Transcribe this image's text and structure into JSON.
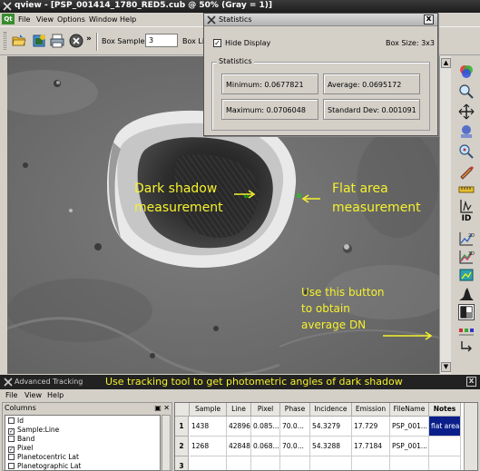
{
  "window": {
    "title": "qview - [PSP_001414_1780_RED5.cub @ 50% (Gray = 1)]"
  },
  "menubar": {
    "logo": "Qt",
    "items": [
      "File",
      "View",
      "Options",
      "Window",
      "Help"
    ]
  },
  "toolbar": {
    "overflow": "»",
    "box_samples_label": "Box Samples:",
    "box_samples_value": "3",
    "box_lines_label": "Box Lin"
  },
  "statistics": {
    "title": "Statistics",
    "hide_display_label": "Hide Display",
    "hide_display_checked": true,
    "box_size": "Box Size:  3x3",
    "group_title": "Statistics",
    "minimum": "Minimum: 0.0677821",
    "average": "Average: 0.0695172",
    "maximum": "Maximum: 0.0706048",
    "std_dev": "Standard Dev: 0.001091",
    "close": "x"
  },
  "annotations": {
    "dark_shadow_1": "Dark shadow",
    "dark_shadow_2": "measurement",
    "flat_area_1": "Flat area",
    "flat_area_2": "measurement",
    "button_1": "Use this button",
    "button_2": "to obtain",
    "button_3": "average  DN",
    "tracking": "Use tracking tool to get photometric  angles of dark shadow",
    "color": "#f6f22c"
  },
  "right_tools": {
    "id_label": "ID"
  },
  "advanced_tracking": {
    "title": "Advanced Tracking",
    "close": "x",
    "menu": [
      "File",
      "View",
      "Help"
    ],
    "columns_header": "Columns",
    "columns_buttons": "▣ ✕",
    "columns": [
      {
        "label": "Id",
        "checked": false
      },
      {
        "label": "Sample:Line",
        "checked": true
      },
      {
        "label": "Band",
        "checked": false
      },
      {
        "label": "Pixel",
        "checked": true
      },
      {
        "label": "Planetocentric Lat",
        "checked": false
      },
      {
        "label": "Planetographic Lat",
        "checked": false
      }
    ],
    "table": {
      "headers": [
        "Sample",
        "Line",
        "Pixel",
        "Phase",
        "Incidence",
        "Emission",
        "FileName",
        "Notes"
      ],
      "rows": [
        {
          "num": "1",
          "cells": [
            "1438",
            "42896",
            "0.085...",
            "70.0...",
            "54.3279",
            "17.729",
            "PSP_001...",
            "flat area"
          ]
        },
        {
          "num": "2",
          "cells": [
            "1268",
            "42848",
            "0.068...",
            "70.0...",
            "54.3288",
            "17.7184",
            "PSP_001...",
            ""
          ]
        },
        {
          "num": "3",
          "cells": [
            "",
            "",
            "",
            "",
            "",
            "",
            "",
            ""
          ]
        }
      ]
    }
  }
}
